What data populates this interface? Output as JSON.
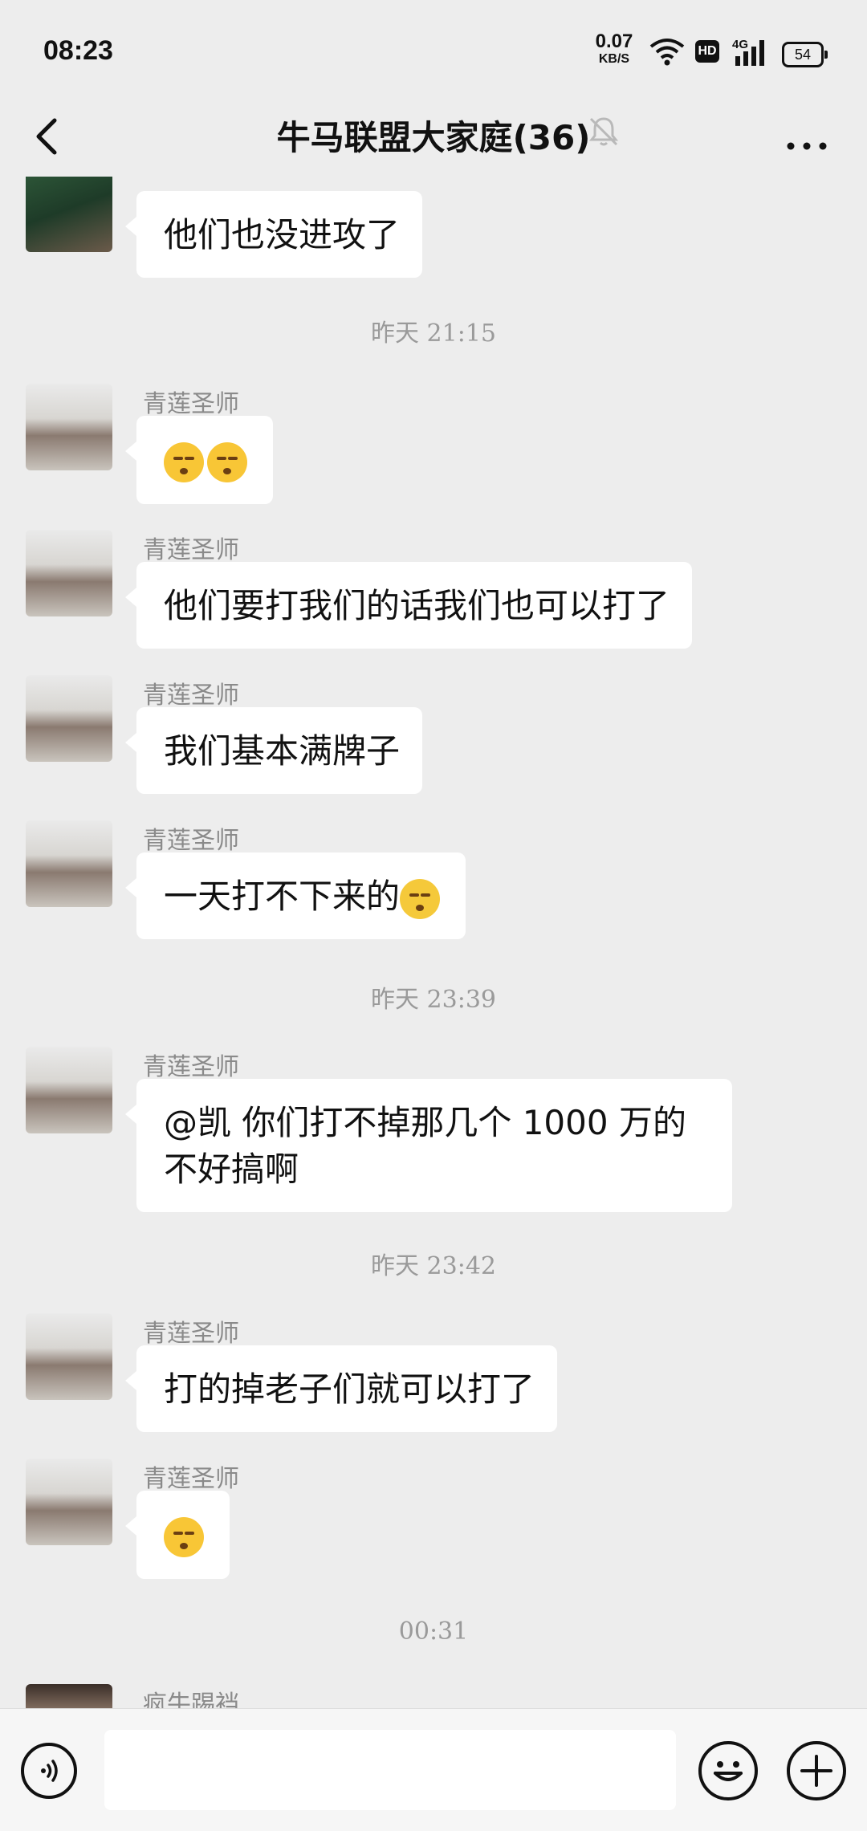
{
  "status_bar": {
    "time": "08:23",
    "net_speed_value": "0.07",
    "net_speed_unit": "KB/S",
    "hd_label": "HD",
    "network_type": "4G",
    "battery": "54"
  },
  "nav": {
    "title": "牛马联盟大家庭(36)"
  },
  "chat": {
    "messages": [
      {
        "sender": "",
        "text": "他们也没进攻了"
      },
      {
        "time": "昨天 21:15"
      },
      {
        "sender": "青莲圣师",
        "text": ""
      },
      {
        "sender": "青莲圣师",
        "text": "他们要打我们的话我们也可以打了"
      },
      {
        "sender": "青莲圣师",
        "text": "我们基本满牌子"
      },
      {
        "sender": "青莲圣师",
        "text": "一天打不下来的"
      },
      {
        "time": "昨天 23:39"
      },
      {
        "sender": "青莲圣师",
        "text_line1": "@凯  你们打不掉那几个 1000 万的",
        "text_line2": "不好搞啊"
      },
      {
        "time": "昨天 23:42"
      },
      {
        "sender": "青莲圣师",
        "text": "打的掉老子们就可以打了"
      },
      {
        "sender": "青莲圣师",
        "text": ""
      },
      {
        "time": "00:31"
      },
      {
        "sender": "疯牛踢裆",
        "text": ""
      }
    ]
  }
}
